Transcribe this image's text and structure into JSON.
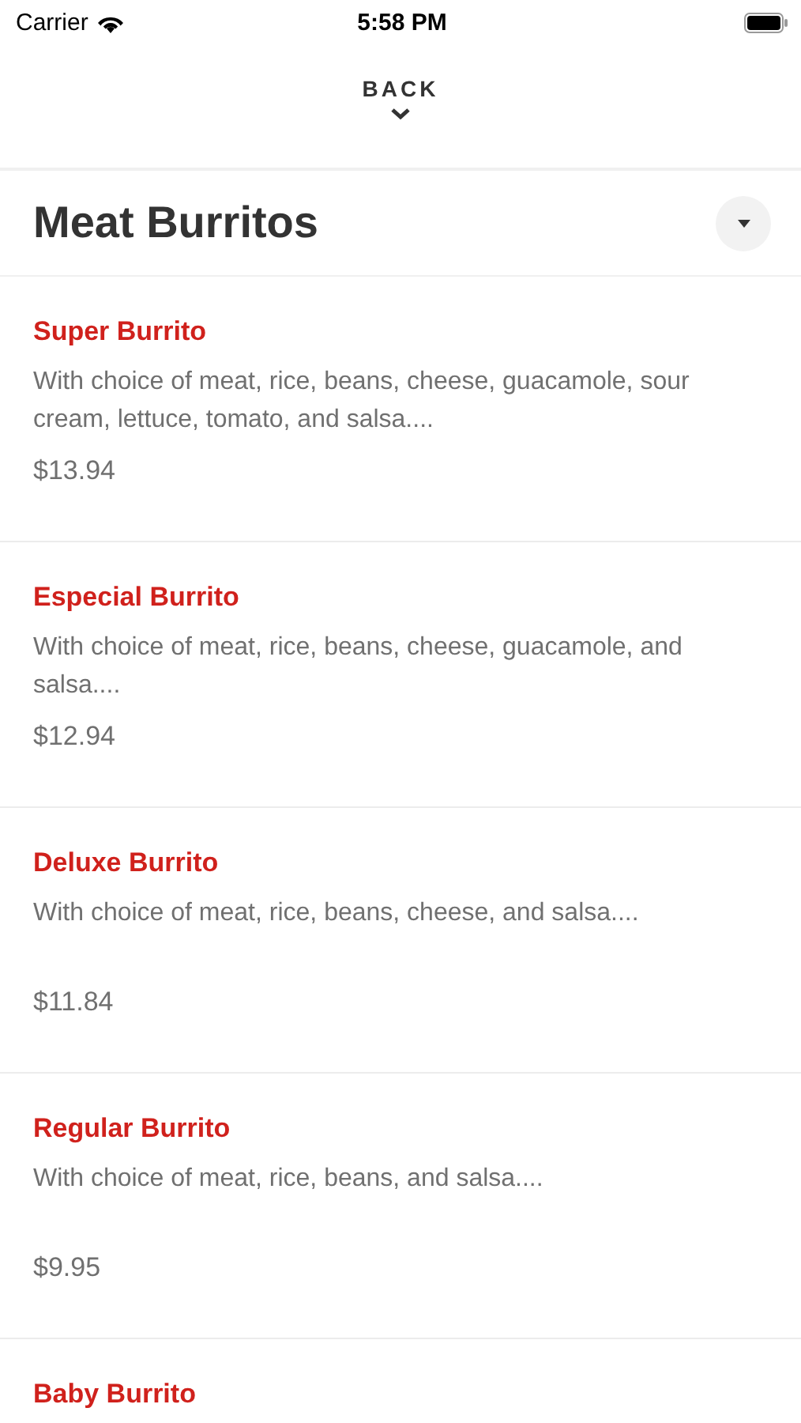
{
  "status_bar": {
    "carrier": "Carrier",
    "time": "5:58 PM"
  },
  "back": {
    "label": "BACK"
  },
  "category": {
    "title": "Meat Burritos"
  },
  "items": [
    {
      "name": "Super Burrito",
      "description": "With choice of meat, rice, beans, cheese, guacamole, sour cream, lettuce, tomato, and salsa....",
      "price": "$13.94"
    },
    {
      "name": "Especial Burrito",
      "description": "With choice of meat, rice, beans, cheese, guacamole, and salsa....",
      "price": "$12.94"
    },
    {
      "name": "Deluxe Burrito",
      "description": "With choice of meat, rice, beans, cheese, and salsa....",
      "price": "$11.84"
    },
    {
      "name": "Regular Burrito",
      "description": "With choice of meat, rice, beans, and salsa....",
      "price": "$9.95"
    },
    {
      "name": "Baby Burrito"
    }
  ]
}
